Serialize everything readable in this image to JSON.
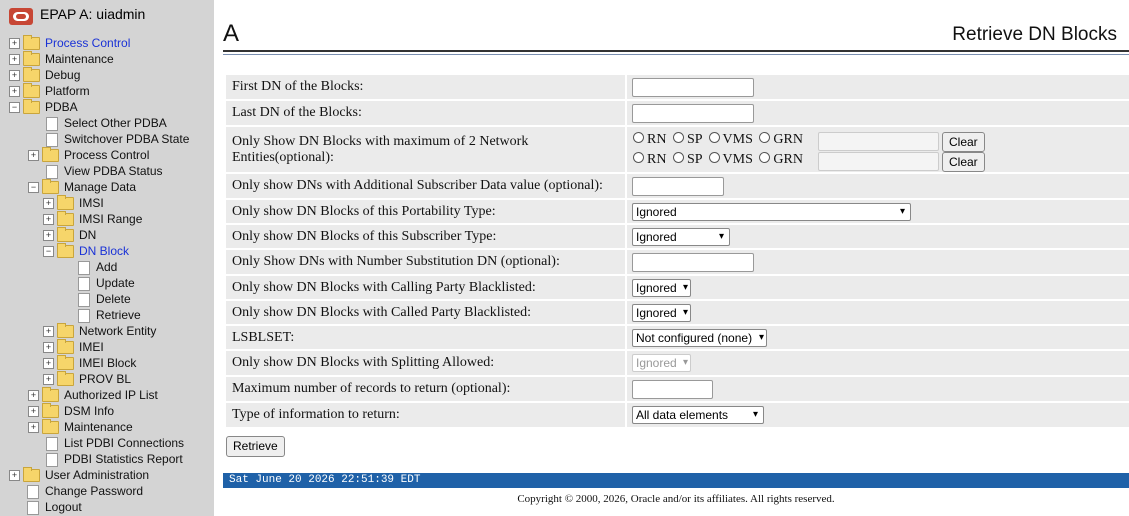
{
  "sidebar": {
    "title": "EPAP A: uiadmin",
    "items": [
      {
        "label": "Process Control",
        "toggle": "+"
      },
      {
        "label": "Maintenance",
        "toggle": "+"
      },
      {
        "label": "Debug",
        "toggle": "+"
      },
      {
        "label": "Platform",
        "toggle": "+"
      },
      {
        "label": "PDBA",
        "toggle": "−"
      },
      {
        "label": "Select Other PDBA"
      },
      {
        "label": "Switchover PDBA State"
      },
      {
        "label": "Process Control",
        "toggle": "+"
      },
      {
        "label": "View PDBA Status"
      },
      {
        "label": "Manage Data",
        "toggle": "−"
      },
      {
        "label": "IMSI",
        "toggle": "+"
      },
      {
        "label": "IMSI Range",
        "toggle": "+"
      },
      {
        "label": "DN",
        "toggle": "+"
      },
      {
        "label": "DN Block",
        "toggle": "−"
      },
      {
        "label": "Add"
      },
      {
        "label": "Update"
      },
      {
        "label": "Delete"
      },
      {
        "label": "Retrieve"
      },
      {
        "label": "Network Entity",
        "toggle": "+"
      },
      {
        "label": "IMEI",
        "toggle": "+"
      },
      {
        "label": "IMEI Block",
        "toggle": "+"
      },
      {
        "label": "PROV BL",
        "toggle": "+"
      },
      {
        "label": "Authorized IP List",
        "toggle": "+"
      },
      {
        "label": "DSM Info",
        "toggle": "+"
      },
      {
        "label": "Maintenance",
        "toggle": "+"
      },
      {
        "label": "List PDBI Connections"
      },
      {
        "label": "PDBI Statistics Report"
      },
      {
        "label": "User Administration",
        "toggle": "+"
      },
      {
        "label": "Change Password"
      },
      {
        "label": "Logout"
      }
    ]
  },
  "header": {
    "system_letter": "A",
    "page_title": "Retrieve DN Blocks"
  },
  "form": {
    "rows": [
      {
        "label": "First DN of the Blocks:"
      },
      {
        "label": "Last DN of the Blocks:"
      },
      {
        "label": "Only Show DN Blocks with maximum of 2 Network Entities(optional):"
      },
      {
        "label": "Only show DNs with Additional Subscriber Data value (optional):"
      },
      {
        "label": "Only show DN Blocks of this Portability Type:",
        "value": "Ignored"
      },
      {
        "label": "Only show DN Blocks of this Subscriber Type:",
        "value": "Ignored"
      },
      {
        "label": "Only Show DNs with Number Substitution DN (optional):"
      },
      {
        "label": "Only show DN Blocks with Calling Party Blacklisted:",
        "value": "Ignored"
      },
      {
        "label": "Only show DN Blocks with Called Party Blacklisted:",
        "value": "Ignored"
      },
      {
        "label": "LSBLSET:",
        "value": "Not configured (none)"
      },
      {
        "label": "Only show DN Blocks with Splitting Allowed:",
        "value": "Ignored"
      },
      {
        "label": "Maximum number of records to return (optional):"
      },
      {
        "label": "Type of information to return:",
        "value": "All data elements"
      }
    ],
    "radio_options": [
      "RN",
      "SP",
      "VMS",
      "GRN"
    ],
    "clear_label": "Clear",
    "retrieve_label": "Retrieve"
  },
  "footer": {
    "timestamp": "Sat June 20 2026 22:51:39 EDT",
    "copyright": "Copyright © 2000, 2026, Oracle and/or its affiliates. All rights reserved."
  }
}
